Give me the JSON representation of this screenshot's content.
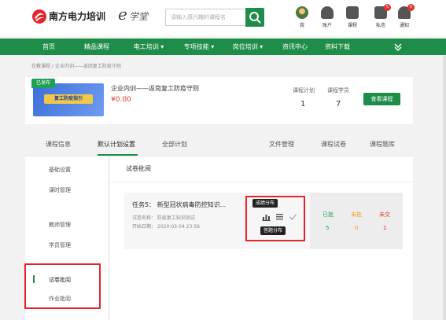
{
  "header": {
    "logo_text": "南方电力培训",
    "logo_e": "e",
    "logo_sub": "学堂",
    "search_placeholder": "请输入感兴趣的课程名",
    "icons": [
      {
        "name": "avatar",
        "label": "我"
      },
      {
        "name": "account-icon",
        "label": "账户"
      },
      {
        "name": "course-icon",
        "label": "课程"
      },
      {
        "name": "message-icon",
        "label": "私信",
        "badge": "5"
      },
      {
        "name": "notification-icon",
        "label": "通知",
        "badge": "5"
      }
    ]
  },
  "nav": {
    "items": [
      "首页",
      "精品课程",
      "电工培训 ▾",
      "专项技能 ▾",
      "岗位培训 ▾",
      "资讯中心",
      "资料下载"
    ],
    "more_icon": "double-chevron-down-icon"
  },
  "breadcrumb": "在教课程 / 企业内训——返岗复工防疫守则",
  "course": {
    "status": "已发布",
    "thumb_title": "复工防疫指引",
    "name": "企业内训——返岗复工防疫守则",
    "price": "¥0.00",
    "plan_label": "课程计划",
    "plan_value": "1",
    "students_label": "课程学员",
    "students_value": "7",
    "view_button": "查看课程"
  },
  "tabs": [
    "课程信息",
    "默认计划设置",
    "全部计划",
    "文件管理",
    "课程试卷",
    "课程题库"
  ],
  "active_tab": "默认计划设置",
  "side_menu": [
    "基础设置",
    "课时管理",
    "教师管理",
    "学员管理",
    "试卷批阅",
    "作业批阅"
  ],
  "main": {
    "title": "试卷批阅",
    "task": {
      "title": "任务5： 新型冠状病毒防控知识...",
      "paper": "试卷名称： 防疫复工知识测试",
      "date": "开始日期： 2020-03-04 23:56",
      "tooltip_top": "成绩分布",
      "tooltip_bottom": "答题分布",
      "counts": [
        {
          "label": "已批",
          "value": "5",
          "color": "#21a055"
        },
        {
          "label": "未批",
          "value": "0",
          "color": "#f0a020"
        },
        {
          "label": "未交",
          "value": "1",
          "color": "#e3352d"
        }
      ]
    }
  },
  "colors": {
    "brand": "#1e8d4a",
    "highlight": "#e3242b"
  }
}
